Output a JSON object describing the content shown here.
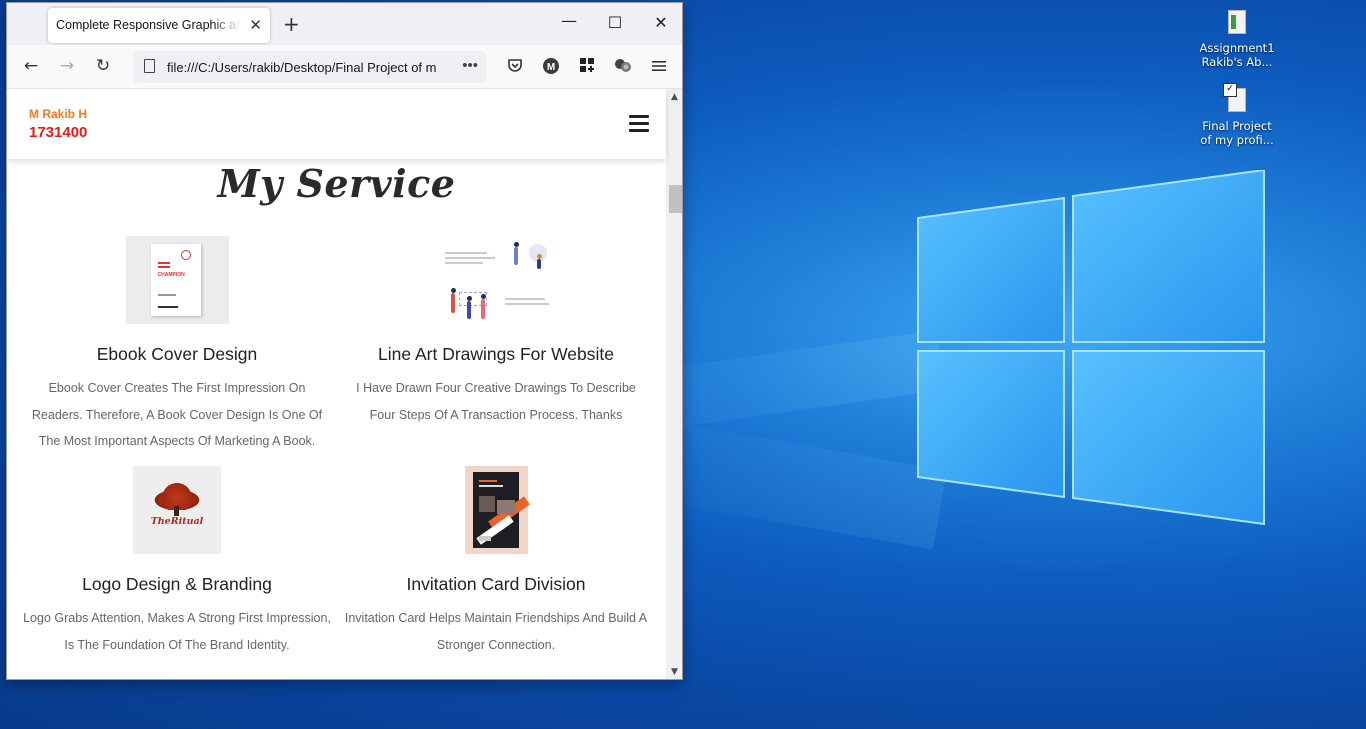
{
  "desktop": {
    "icons": [
      {
        "name": "Assignment1 Rakib's Ab...",
        "line1": "Assignment1",
        "line2": "Rakib's Ab..."
      },
      {
        "name": "Final Project of my profi...",
        "line1": "Final Project",
        "line2": "of my profi..."
      }
    ]
  },
  "browser": {
    "tab": {
      "title": "Complete Responsive Graphic and w",
      "close": "✕"
    },
    "new_tab": "+",
    "window_controls": {
      "minimize": "—",
      "maximize": "☐",
      "close": "✕"
    },
    "nav": {
      "back": "←",
      "forward": "→",
      "reload": "↻"
    },
    "url": "file:///C:/Users/rakib/Desktop/Final Project of m",
    "url_more": "•••",
    "toolbar_icons": [
      "pocket-icon",
      "account-icon",
      "extensions-icon",
      "containers-icon",
      "menu-icon"
    ]
  },
  "site": {
    "brand": {
      "name": "M Rakib H",
      "id": "1731400"
    },
    "section_title": "My Service",
    "services": [
      {
        "title": "Ebook Cover Design",
        "description": "Ebook Cover Creates The First Impression On Readers. Therefore, A Book Cover Design Is One Of The Most Important Aspects Of Marketing A Book.",
        "thumb_text": "CHAMPION"
      },
      {
        "title": "Line Art Drawings For Website",
        "description": "I Have Drawn Four Creative Drawings To Describe Four Steps Of A Transaction Process. Thanks"
      },
      {
        "title": "Logo Design & Branding",
        "description": "Logo Grabs Attention, Makes A Strong First Impression, Is The Foundation Of The Brand Identity.",
        "thumb_text": "TheRitual"
      },
      {
        "title": "Invitation Card Division",
        "description": "Invitation Card Helps Maintain Friendships And Build A Stronger Connection."
      }
    ]
  },
  "colors": {
    "brand_name": "#f2791d",
    "brand_id": "#e01b1b",
    "title": "#2a2a2a",
    "desktop_blue": "#0a47a3"
  }
}
